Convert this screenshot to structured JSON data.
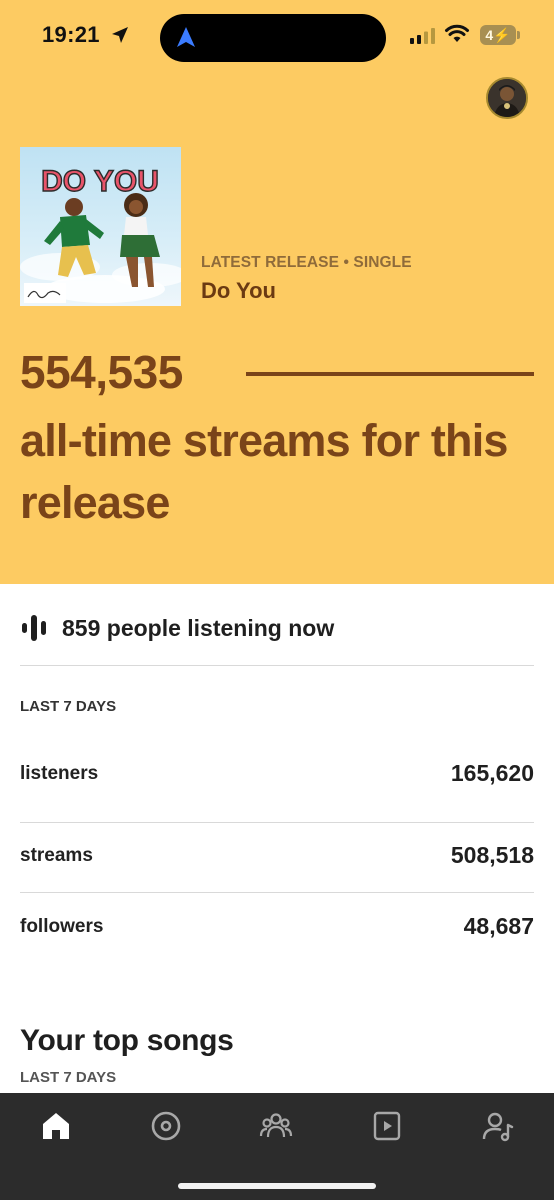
{
  "status_bar": {
    "time": "19:21",
    "battery": "4"
  },
  "release": {
    "label": "LATEST RELEASE • SINGLE",
    "title": "Do You",
    "cover_text": "DO YOU"
  },
  "hero": {
    "stream_count": "554,535",
    "caption": "all-time streams for this release"
  },
  "live": {
    "text": "859 people listening now"
  },
  "last7": {
    "label": "LAST 7 DAYS",
    "rows": [
      {
        "label": "listeners",
        "value": "165,620"
      },
      {
        "label": "streams",
        "value": "508,518"
      },
      {
        "label": "followers",
        "value": "48,687"
      }
    ]
  },
  "top_songs": {
    "title": "Your top songs",
    "subtitle": "LAST 7 DAYS"
  },
  "tabs": [
    {
      "icon": "home-icon",
      "active": true
    },
    {
      "icon": "music-disc-icon",
      "active": false
    },
    {
      "icon": "audience-icon",
      "active": false
    },
    {
      "icon": "video-icon",
      "active": false
    },
    {
      "icon": "profile-music-icon",
      "active": false
    }
  ],
  "colors": {
    "hero_bg": "#fdcb62",
    "brown": "#7a4419",
    "tabbar_bg": "#2c2c2c"
  }
}
